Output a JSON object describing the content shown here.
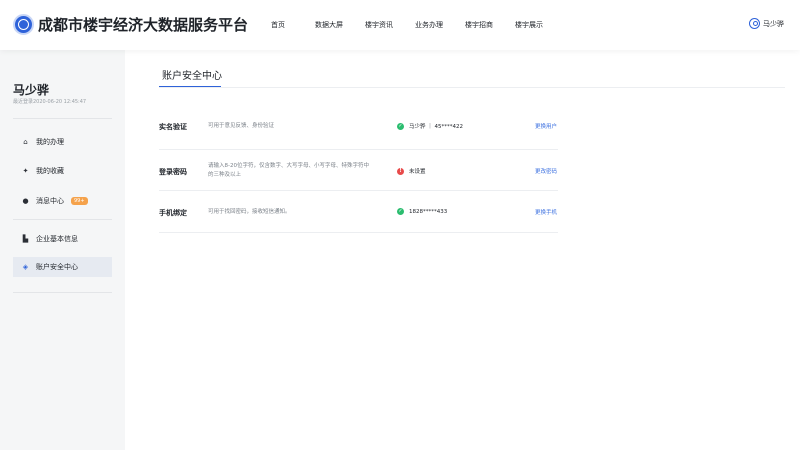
{
  "header": {
    "brand": "成都市楼宇经济大数据服务平台",
    "nav": [
      "首页",
      "数据大屏",
      "楼宇资讯",
      "业务办理",
      "楼宇招商",
      "楼宇展示"
    ],
    "user_name": "马少骅"
  },
  "sidebar": {
    "name": "马少骅",
    "last_login": "最近登录2020-06-20 12:45:47",
    "items": [
      {
        "label": "我的办理",
        "icon": "home-icon"
      },
      {
        "label": "我的收藏",
        "icon": "star-icon"
      },
      {
        "label": "消息中心",
        "icon": "message-icon",
        "badge": "99+"
      },
      {
        "label": "企业基本信息",
        "icon": "building-icon"
      },
      {
        "label": "账户安全中心",
        "icon": "shield-icon",
        "active": true
      }
    ]
  },
  "main": {
    "tab": "账户安全中心",
    "rows": [
      {
        "title": "实名验证",
        "desc": "可用于意见反馈、身份验证",
        "status": "马少骅 ｜ 45****422",
        "status_type": "ok",
        "action": "更换用户"
      },
      {
        "title": "登录密码",
        "desc_line1": "请输入8-20位字符，仅含数字、大写字母、小写字母、特殊字符中",
        "desc_line2": "的三种及以上",
        "status": "未设置",
        "status_type": "warn",
        "action": "更改密码"
      },
      {
        "title": "手机绑定",
        "desc": "可用于找回密码，接收短信通知。",
        "status": "1828*****433",
        "status_type": "ok",
        "action": "更换手机"
      }
    ]
  },
  "colors": {
    "accent": "#2e62d9",
    "ok": "#2bbd6f",
    "warn": "#e84a4a",
    "badge": "#f5a24b"
  }
}
